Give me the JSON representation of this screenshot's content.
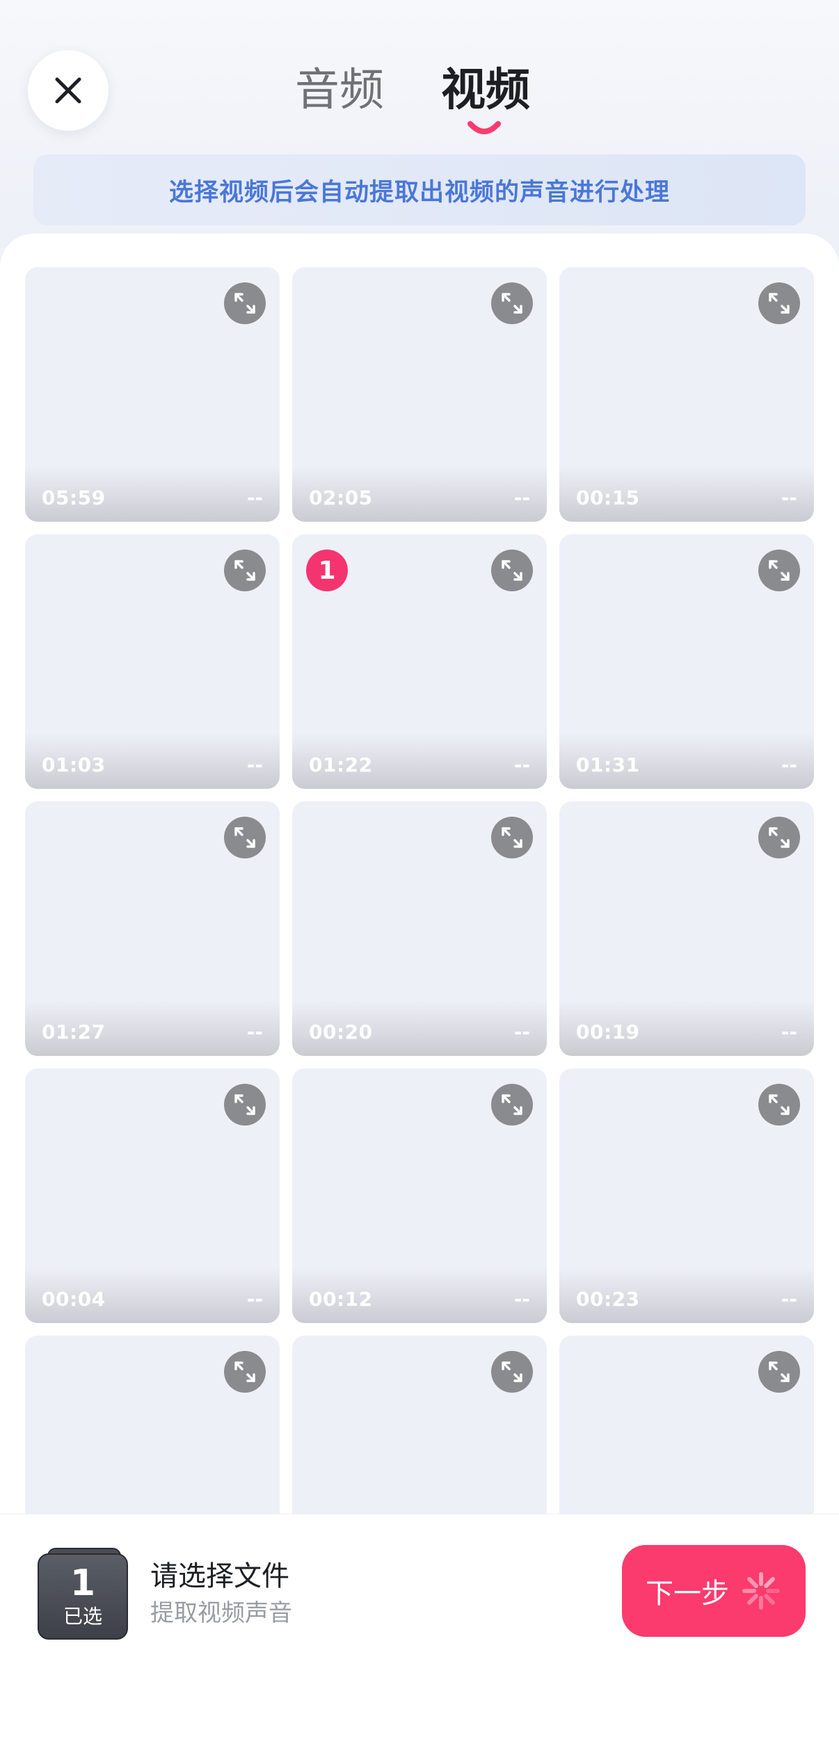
{
  "header": {
    "tabs": [
      {
        "label": "音频",
        "active": false
      },
      {
        "label": "视频",
        "active": true
      }
    ],
    "hint": "选择视频后会自动提取出视频的声音进行处理"
  },
  "colors": {
    "accent": "#fb3a6d",
    "hint_text": "#4a77d8"
  },
  "grid": {
    "tiles": [
      {
        "duration": "05:59",
        "size": "--"
      },
      {
        "duration": "02:05",
        "size": "--"
      },
      {
        "duration": "00:15",
        "size": "--"
      },
      {
        "duration": "01:03",
        "size": "--"
      },
      {
        "duration": "01:22",
        "size": "--",
        "selected_index": "1"
      },
      {
        "duration": "01:31",
        "size": "--"
      },
      {
        "duration": "01:27",
        "size": "--"
      },
      {
        "duration": "00:20",
        "size": "--"
      },
      {
        "duration": "00:19",
        "size": "--"
      },
      {
        "duration": "00:04",
        "size": "--"
      },
      {
        "duration": "00:12",
        "size": "--"
      },
      {
        "duration": "00:23",
        "size": "--"
      },
      {
        "duration": "",
        "size": ""
      },
      {
        "duration": "",
        "size": ""
      },
      {
        "duration": "",
        "size": ""
      }
    ]
  },
  "bottom": {
    "selected_count": "1",
    "selected_label": "已选",
    "title": "请选择文件",
    "subtitle": "提取视频声音",
    "next_label": "下一步"
  },
  "icons": {
    "close": "close-icon",
    "expand": "expand-icon",
    "loading": "loading-spinner-icon"
  }
}
